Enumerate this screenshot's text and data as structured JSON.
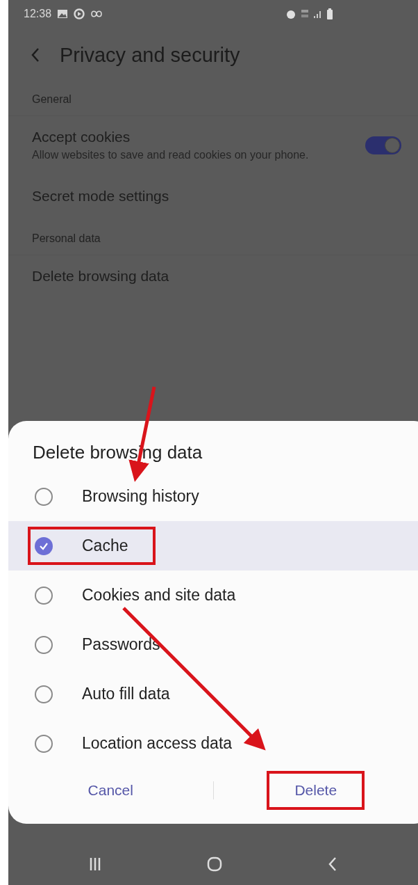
{
  "status_bar": {
    "time": "12:38"
  },
  "header": {
    "title": "Privacy and security"
  },
  "settings": [
    {
      "kind": "section",
      "label": "General"
    },
    {
      "kind": "toggle",
      "label": "Accept cookies",
      "description": "Allow websites to save and read cookies on your phone.",
      "on": true
    },
    {
      "kind": "item",
      "label": "Secret mode settings"
    },
    {
      "kind": "section",
      "label": "Personal data"
    },
    {
      "kind": "item",
      "label": "Delete browsing data"
    }
  ],
  "dialog": {
    "title": "Delete browsing data",
    "options": [
      {
        "label": "Browsing history",
        "checked": false,
        "highlighted": false
      },
      {
        "label": "Cache",
        "checked": true,
        "highlighted": true
      },
      {
        "label": "Cookies and site data",
        "checked": false,
        "highlighted": false
      },
      {
        "label": "Passwords",
        "checked": false,
        "highlighted": false
      },
      {
        "label": "Auto fill data",
        "checked": false,
        "highlighted": false
      },
      {
        "label": "Location access data",
        "checked": false,
        "highlighted": false
      }
    ],
    "buttons": [
      {
        "label": "Cancel",
        "highlighted": false
      },
      {
        "label": "Delete",
        "highlighted": true
      }
    ]
  }
}
